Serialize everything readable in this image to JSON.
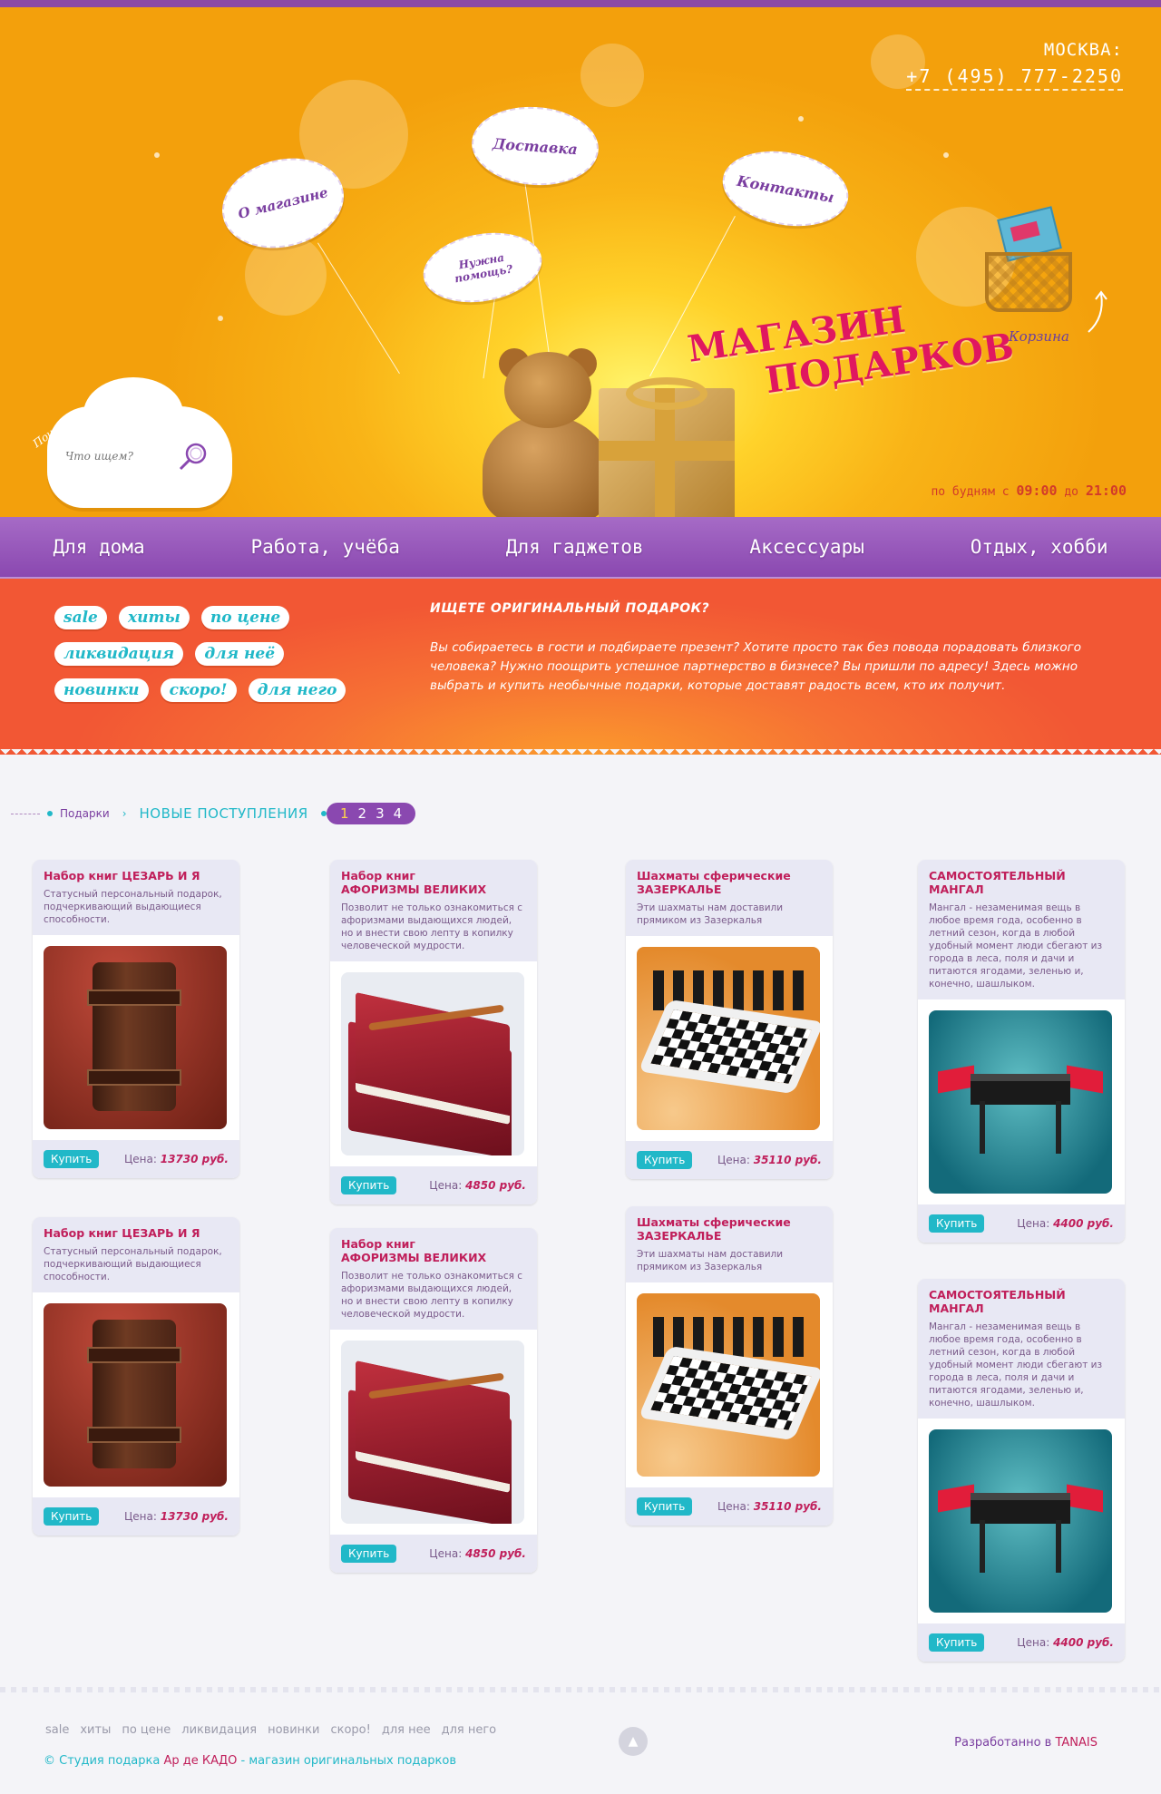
{
  "header": {
    "city": "МОСКВА:",
    "phone": "+7 (495) 777-2250",
    "title_line1": "МАГАЗИН",
    "title_line2": "ПОДАРКОВ",
    "hours_prefix": "по будням с ",
    "hours_from": "09:00",
    "hours_mid": " до ",
    "hours_to": "21:00",
    "cart_label": "Корзина",
    "clouds": {
      "about": "О магазине",
      "delivery": "Доставка",
      "help": "Нужна помощь?",
      "contacts": "Контакты"
    },
    "search": {
      "label": "Поиск",
      "placeholder": "Что ищем?"
    }
  },
  "nav": [
    "Для дома",
    "Работа, учёба",
    "Для гаджетов",
    "Аксессуары",
    "Отдых, хобби"
  ],
  "tags": [
    "sale",
    "хиты",
    "по цене",
    "ликвидация",
    "для неё",
    "новинки",
    "скоро!",
    "для него"
  ],
  "promo": {
    "title": "ИЩЕТЕ ОРИГИНАЛЬНЫЙ ПОДАРОК?",
    "text": "Вы собираетесь в гости и подбираете презент? Хотите просто так без повода порадовать близкого человека? Нужно поощрить успешное партнерство в бизнесе? Вы пришли по адресу! Здесь можно выбрать и купить необычные подарки, которые доставят радость всем, кто их получит."
  },
  "breadcrumb": {
    "parent": "Подарки",
    "current": "НОВЫЕ ПОСТУПЛЕНИЯ"
  },
  "pages": [
    "1",
    "2",
    "3",
    "4"
  ],
  "active_page": "1",
  "buy_label": "Купить",
  "price_label": "Цена:",
  "products": [
    {
      "name": "Набор книг ЦЕЗАРЬ И Я",
      "desc": "Статусный персональный подарок, подчеркивающий выдающиеся способности.",
      "price": "13730 руб.",
      "image": "leather-book"
    },
    {
      "name": "Набор книг\nАФОРИЗМЫ ВЕЛИКИХ",
      "desc": "Позволит не только ознакомиться с афоризмами выдающихся людей, но и внести свою лепту в копилку человеческой мудрости.",
      "price": "4850 руб.",
      "image": "red-books"
    },
    {
      "name": "Шахматы сферические\nЗАЗЕРКАЛЬЕ",
      "desc": "Эти шахматы нам доставили прямиком из Зазеркалья",
      "price": "35110 руб.",
      "image": "chess"
    },
    {
      "name": "САМОСТОЯТЕЛЬНЫЙ\nМАНГАЛ",
      "desc": "Мангал - незаменимая вещь в любое время года, особенно в летний сезон, когда в любой удобный момент люди сбегают из города в леса, поля и дачи и питаются ягодами, зеленью и, конечно, шашлыком.",
      "price": "4400 руб.",
      "image": "grill"
    }
  ],
  "footer": {
    "links": [
      "sale",
      "хиты",
      "по цене",
      "ликвидация",
      "новинки",
      "скоро!",
      "для нее",
      "для него"
    ],
    "copyright_prefix": "© Студия подарка ",
    "copyright_brand": "Ар де КАДО",
    "copyright_suffix": " - магазин оригинальных подарков",
    "developer_prefix": "Разработанно в ",
    "developer_brand": "TANAIS",
    "up_icon": "arrow-up-icon"
  }
}
